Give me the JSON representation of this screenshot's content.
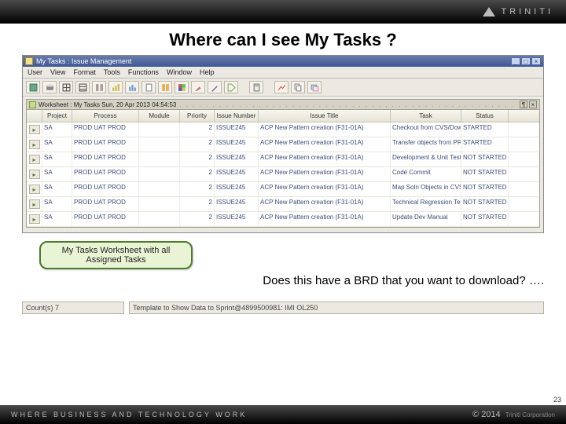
{
  "brand": {
    "name": "TRINITI",
    "tagline": "WHERE BUSINESS AND TECHNOLOGY WORK",
    "copyright": "© 2014",
    "corp": "Triniti Corporation"
  },
  "slide": {
    "title": "Where can I see My Tasks ?",
    "callout": "My Tasks Worksheet with all Assigned Tasks",
    "question": "Does this have a BRD that you want to download? ….",
    "page_num": "23"
  },
  "window": {
    "title": "My Tasks : Issue Management",
    "menu": [
      "User",
      "View",
      "Format",
      "Tools",
      "Functions",
      "Window",
      "Help"
    ],
    "worksheet_title": "Worksheet : My Tasks Sun, 20 Apr 2013 04:54:53",
    "statusbar": {
      "left": "Count(s) 7",
      "right": "Template to Show Data to Sprint@4899500981: IMI OL250"
    }
  },
  "columns": [
    "",
    "Project",
    "Process",
    "Module",
    "Priority",
    "Issue Number",
    "Issue Title",
    "Task",
    "Status"
  ],
  "rows": [
    {
      "project": "SA",
      "process": "PROD UAT PROD",
      "module": "",
      "priority": "2",
      "issue_num": "ISSUE245",
      "issue_title": "ACP New Pattern creation (F31-01A)",
      "task": "Checkout from CVS/Download from PROD",
      "status": "STARTED"
    },
    {
      "project": "SA",
      "process": "PROD UAT PROD",
      "module": "",
      "priority": "2",
      "issue_num": "ISSUE245",
      "issue_title": "ACP New Pattern creation (F31-01A)",
      "task": "Transfer objects from PROD",
      "status": "STARTED"
    },
    {
      "project": "SA",
      "process": "PROD UAT PROD",
      "module": "",
      "priority": "2",
      "issue_num": "ISSUE245",
      "issue_title": "ACP New Pattern creation (F31-01A)",
      "task": "Development & Unit Test",
      "status": "NOT STARTED"
    },
    {
      "project": "SA",
      "process": "PROD UAT PROD",
      "module": "",
      "priority": "2",
      "issue_num": "ISSUE245",
      "issue_title": "ACP New Pattern creation (F31-01A)",
      "task": "Code Commit",
      "status": "NOT STARTED"
    },
    {
      "project": "SA",
      "process": "PROD UAT PROD",
      "module": "",
      "priority": "2",
      "issue_num": "ISSUE245",
      "issue_title": "ACP New Pattern creation (F31-01A)",
      "task": "Map Soln Objects in CVS",
      "status": "NOT STARTED"
    },
    {
      "project": "SA",
      "process": "PROD UAT PROD",
      "module": "",
      "priority": "2",
      "issue_num": "ISSUE245",
      "issue_title": "ACP New Pattern creation (F31-01A)",
      "task": "Technical Regression Testing",
      "status": "NOT STARTED"
    },
    {
      "project": "SA",
      "process": "PROD UAT PROD",
      "module": "",
      "priority": "2",
      "issue_num": "ISSUE245",
      "issue_title": "ACP New Pattern creation (F31-01A)",
      "task": "Update Dev Manual",
      "status": "NOT STARTED"
    }
  ]
}
